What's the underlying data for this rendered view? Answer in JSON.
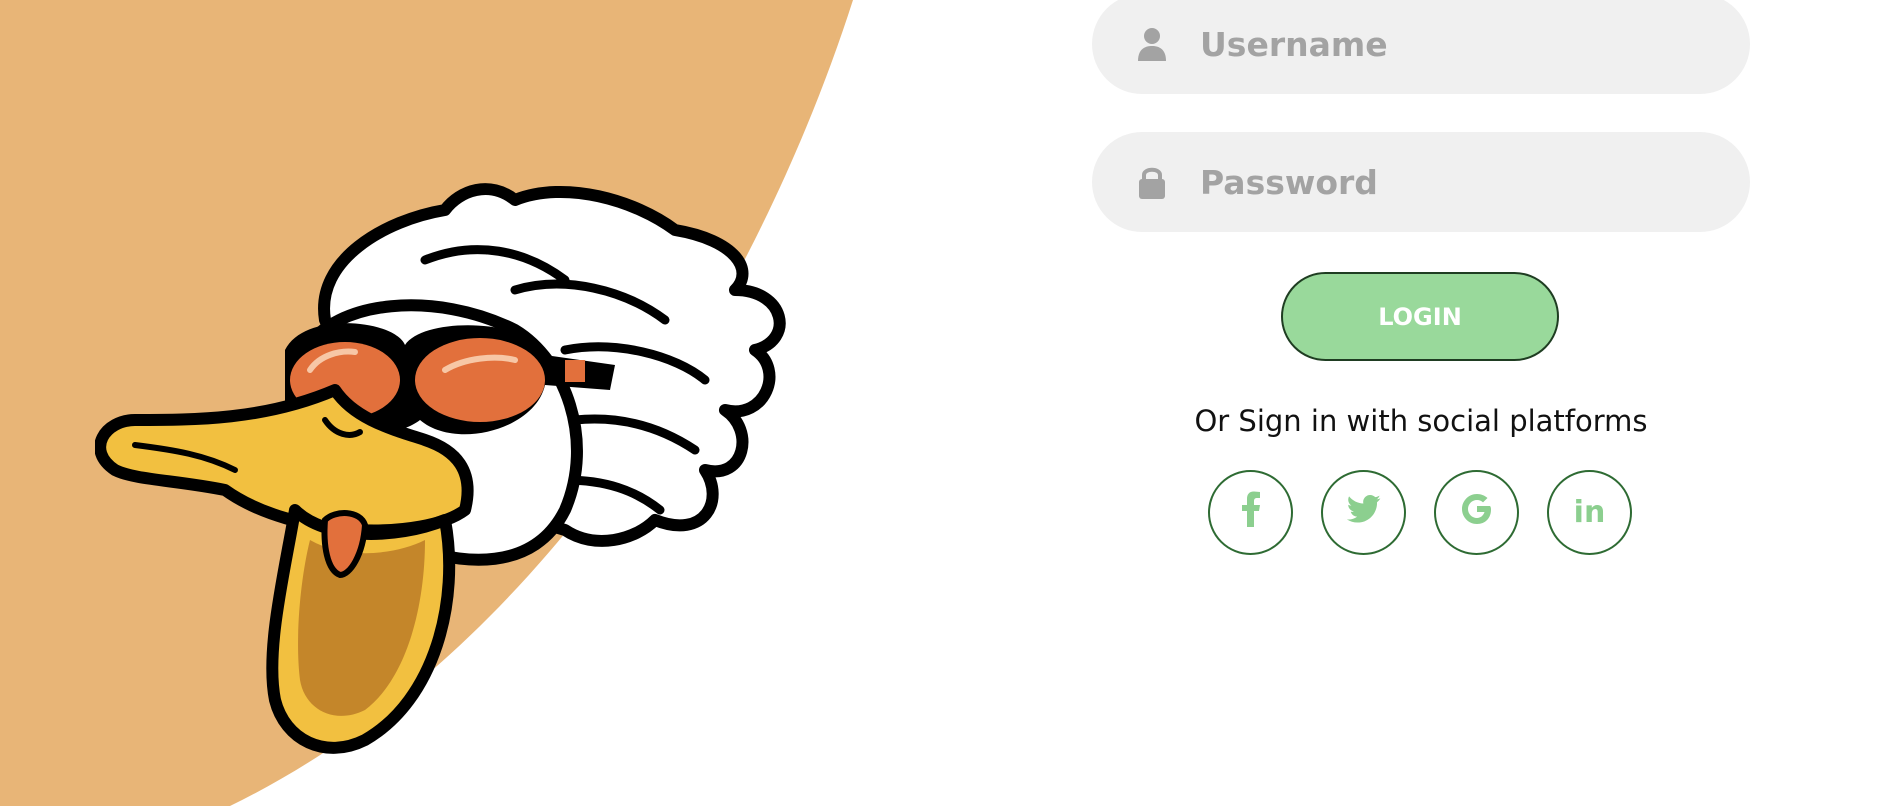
{
  "colors": {
    "background": "#ffffff",
    "accent_shape": "#e8b577",
    "field_bg": "#f0f0f0",
    "button_bg": "#99d99b",
    "social_icon": "#8ccf8f"
  },
  "login_form": {
    "username": {
      "placeholder": "Username",
      "value": "",
      "icon": "user-icon"
    },
    "password": {
      "placeholder": "Password",
      "value": "",
      "icon": "lock-icon"
    },
    "login_button_label": "LOGIN"
  },
  "social": {
    "prompt": "Or Sign in with social platforms",
    "platforms": [
      {
        "name": "facebook",
        "icon": "facebook-icon"
      },
      {
        "name": "twitter",
        "icon": "twitter-icon"
      },
      {
        "name": "google",
        "icon": "google-icon"
      },
      {
        "name": "linkedin",
        "icon": "linkedin-icon",
        "glyph": "in"
      }
    ]
  },
  "mascot": {
    "icon": "duck-mascot-illustration"
  }
}
